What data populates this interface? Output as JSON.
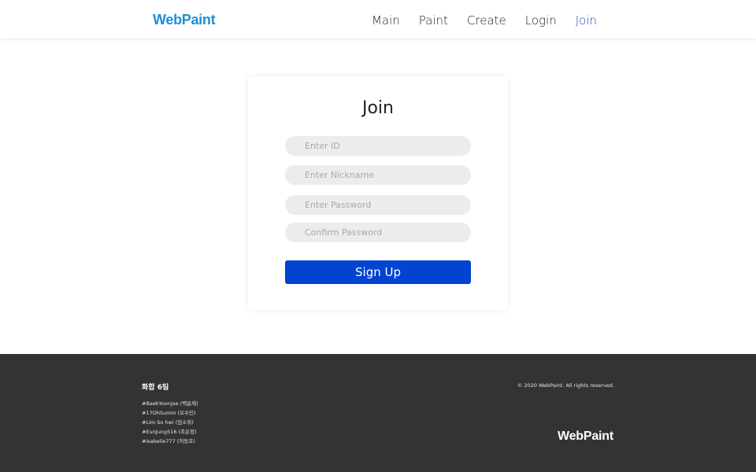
{
  "header": {
    "logo": "WebPaint",
    "nav": [
      {
        "label": "Main",
        "active": false
      },
      {
        "label": "Paint",
        "active": false
      },
      {
        "label": "Create",
        "active": false
      },
      {
        "label": "Login",
        "active": false
      },
      {
        "label": "Join",
        "active": true
      }
    ]
  },
  "join_form": {
    "title": "Join",
    "fields": [
      {
        "placeholder": "Enter ID",
        "value": ""
      },
      {
        "placeholder": "Enter Nickname",
        "value": ""
      },
      {
        "placeholder": "Enter Password",
        "value": ""
      },
      {
        "placeholder": "Confirm Password",
        "value": ""
      }
    ],
    "submit_label": "Sign Up"
  },
  "footer": {
    "team_title": "화합 6팀",
    "members": [
      "#BaekYoonjae (백윤재)",
      "#17OhSumin (오수민)",
      "#Lim So hwi (임소휘)",
      "#EunJung516 (조은정)",
      "#isabelle777 (허동호)"
    ],
    "copyright": "© 2020 WebPaint. All rights reserved.",
    "logo": "WebPaint"
  },
  "colors": {
    "brand": "#1f8ed6",
    "nav_active": "#2748b8",
    "button": "#0343d1",
    "footer_bg": "#333333",
    "input_bg": "#ececec"
  }
}
